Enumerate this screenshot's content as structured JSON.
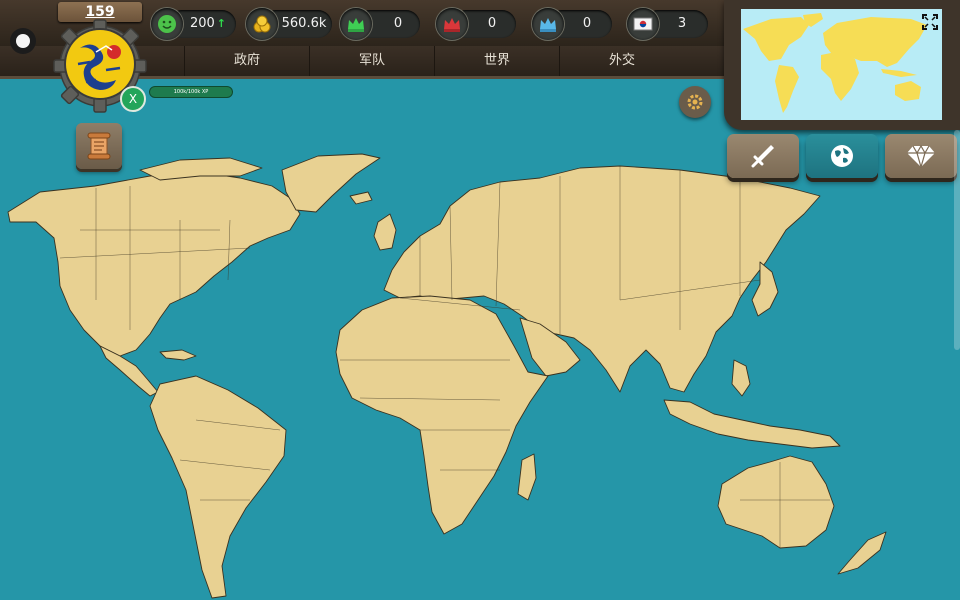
{
  "player": {
    "level": "159",
    "xp_label": "100k/100k XP",
    "badge_letter": "X"
  },
  "resources": {
    "stability": "200",
    "gold": "560.6k",
    "green_crowns": "0",
    "red_crowns": "0",
    "blue_crowns": "0",
    "treaties": "3"
  },
  "tabs": [
    "政府",
    "军队",
    "世界",
    "外交"
  ],
  "colors": {
    "ocean": "#2596a8",
    "land": "#e8d192",
    "minimap_land": "#f6dd55",
    "minimap_ocean": "#b8ecf6",
    "flag_yellow": "#f2c911",
    "positive_green": "#2fd84d"
  },
  "icons": {
    "stability": "smiley-icon",
    "gold": "coins-icon",
    "green_crowns": "green-crown-icon",
    "red_crowns": "red-crown-icon",
    "blue_crowns": "blue-crown-icon",
    "treaties": "treaty-flag-icon",
    "history": "scroll-icon",
    "settings": "gear-icon",
    "expand": "expand-icon",
    "war": "sword-icon",
    "world": "globe-icon",
    "premium": "diamond-icon"
  }
}
